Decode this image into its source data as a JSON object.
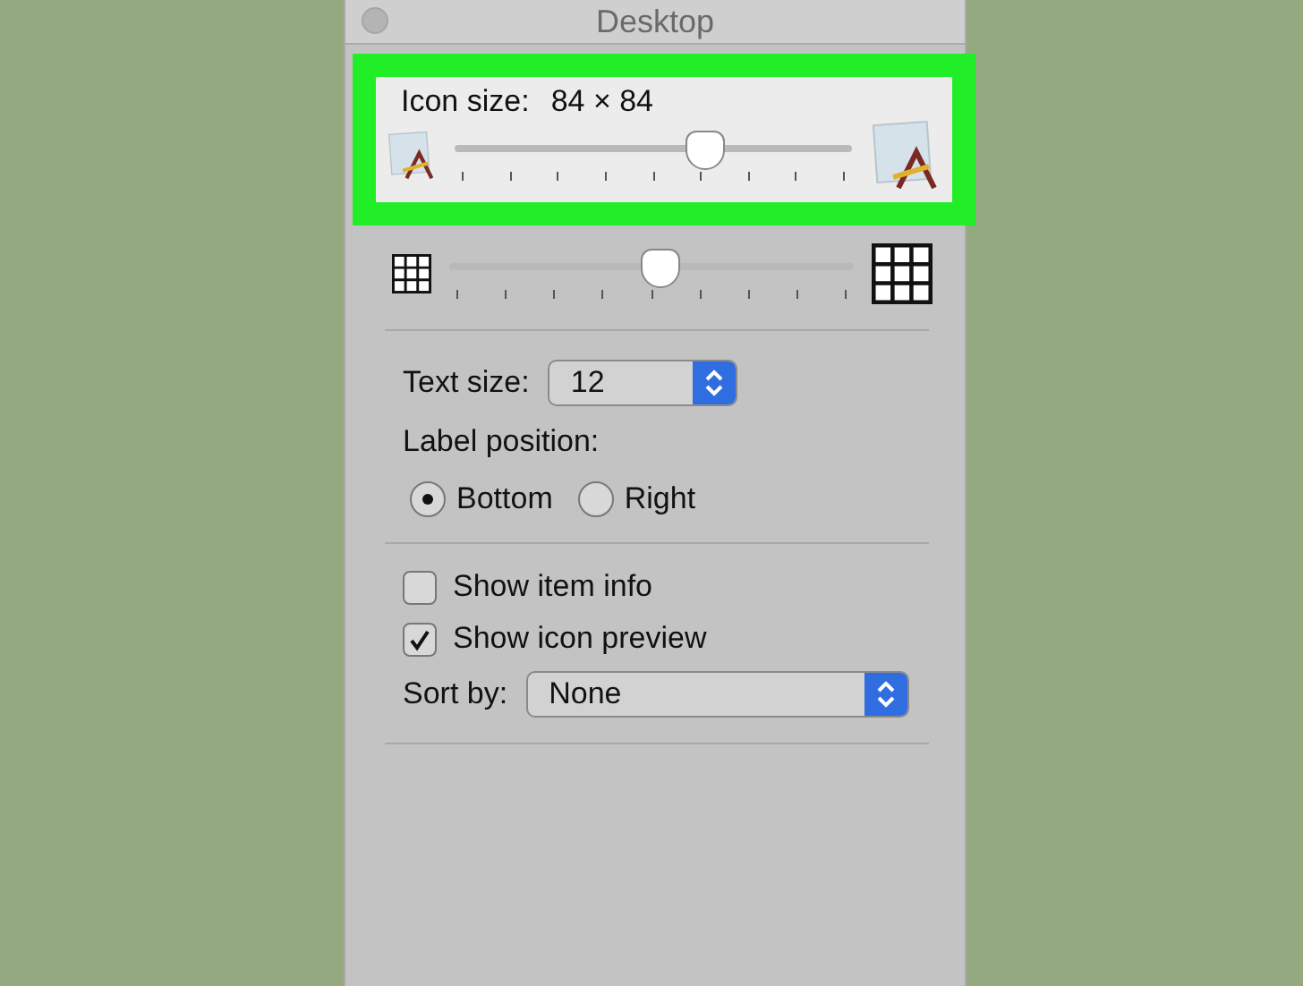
{
  "window": {
    "title": "Desktop"
  },
  "icon_size": {
    "label": "Icon size:",
    "value": "84 × 84",
    "level": 0.63,
    "highlighted": true
  },
  "grid_spacing": {
    "level": 0.52
  },
  "text_size": {
    "label": "Text size:",
    "value": "12"
  },
  "label_position": {
    "label": "Label position:",
    "options": [
      {
        "label": "Bottom",
        "selected": true
      },
      {
        "label": "Right",
        "selected": false
      }
    ]
  },
  "options": [
    {
      "label": "Show item info",
      "checked": false
    },
    {
      "label": "Show icon preview",
      "checked": true
    }
  ],
  "sort_by": {
    "label": "Sort by:",
    "value": "None"
  }
}
